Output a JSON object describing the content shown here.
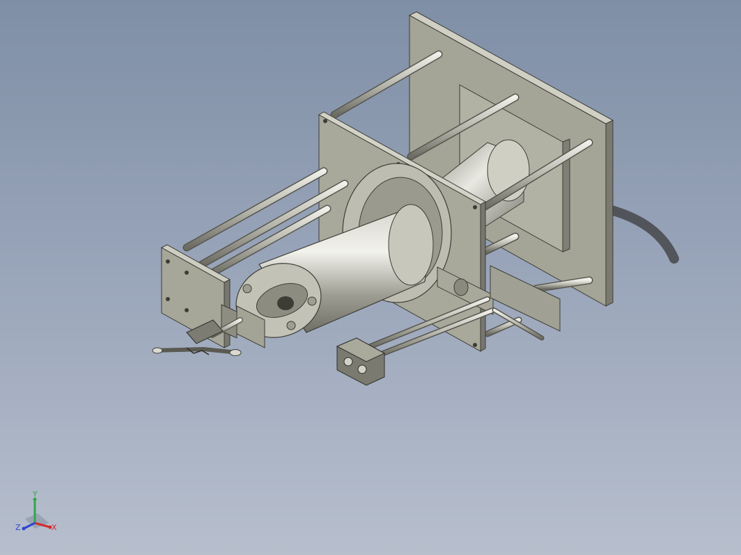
{
  "viewport": {
    "background_top": "#7f8fa6",
    "background_bottom": "#b7bfcd",
    "part_color": "#aeaea2",
    "part_dark": "#6e6e64",
    "part_light": "#d8d8cf"
  },
  "triad": {
    "x_label": "X",
    "y_label": "Y",
    "z_label": "Z",
    "x_color": "#d42a2a",
    "y_color": "#2fa84a",
    "z_color": "#2a44d4"
  }
}
